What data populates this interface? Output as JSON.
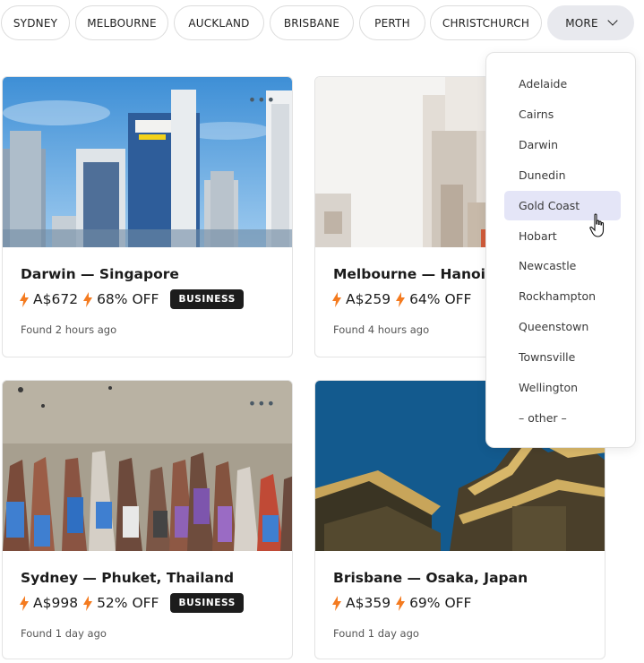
{
  "chips": [
    {
      "label": "SYDNEY"
    },
    {
      "label": "MELBOURNE"
    },
    {
      "label": "AUCKLAND"
    },
    {
      "label": "BRISBANE"
    },
    {
      "label": "PERTH"
    },
    {
      "label": "CHRISTCHURCH"
    }
  ],
  "more_label": "MORE",
  "dropdown": {
    "items": [
      "Adelaide",
      "Cairns",
      "Darwin",
      "Dunedin",
      "Gold Coast",
      "Hobart",
      "Newcastle",
      "Rockhampton",
      "Queenstown",
      "Townsville",
      "Wellington",
      "– other –"
    ],
    "highlighted": "Gold Coast"
  },
  "deals": [
    {
      "route": "Darwin — Singapore",
      "price": "A$672",
      "discount": "68% OFF",
      "badge": "BUSINESS",
      "found": "Found 2 hours ago",
      "photo": "city-skyline"
    },
    {
      "route": "Melbourne — Hanoi, V",
      "price": "A$259",
      "discount": "64% OFF",
      "badge": "",
      "found": "Found 4 hours ago",
      "photo": "street-buildings"
    },
    {
      "route": "Sydney — Phuket, Thailand",
      "price": "A$998",
      "discount": "52% OFF",
      "badge": "BUSINESS",
      "found": "Found 1 day ago",
      "photo": "boats-beach"
    },
    {
      "route": "Brisbane — Osaka, Japan",
      "price": "A$359",
      "discount": "69% OFF",
      "badge": "",
      "found": "Found 1 day ago",
      "photo": "osaka-castle"
    }
  ],
  "colors": {
    "bolt": "#f47b20",
    "badge_bg": "#1c1c1c",
    "highlight": "#e4e5f7"
  }
}
